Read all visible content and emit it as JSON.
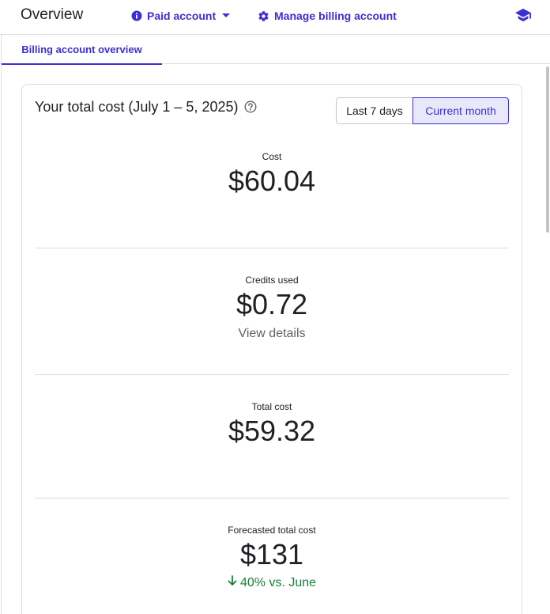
{
  "header": {
    "title": "Overview",
    "account_button": "Paid account",
    "manage_button": "Manage billing account"
  },
  "tabs": [
    {
      "label": "Billing account overview",
      "active": true
    }
  ],
  "card": {
    "title": "Your total cost (July 1 – 5, 2025)",
    "range_options": [
      "Last 7 days",
      "Current month"
    ],
    "selected_range": "Current month",
    "metrics": [
      {
        "label": "Cost",
        "value": "$60.04"
      },
      {
        "label": "Credits used",
        "value": "$0.72",
        "link": "View details"
      },
      {
        "label": "Total cost",
        "value": "$59.32"
      },
      {
        "label": "Forecasted total cost",
        "value": "$131",
        "trend": "40% vs. June",
        "trend_direction": "down"
      }
    ]
  },
  "colors": {
    "accent": "#3c2fd4",
    "accent_bg": "#e9e8fb",
    "positive": "#188038",
    "muted_text": "#5f6368",
    "divider": "#dadce0"
  },
  "icons": {
    "account": "info-icon",
    "manage": "gear-icon",
    "learn": "graduation-cap-icon",
    "help": "help-circle-icon",
    "trend": "arrow-down-icon"
  }
}
